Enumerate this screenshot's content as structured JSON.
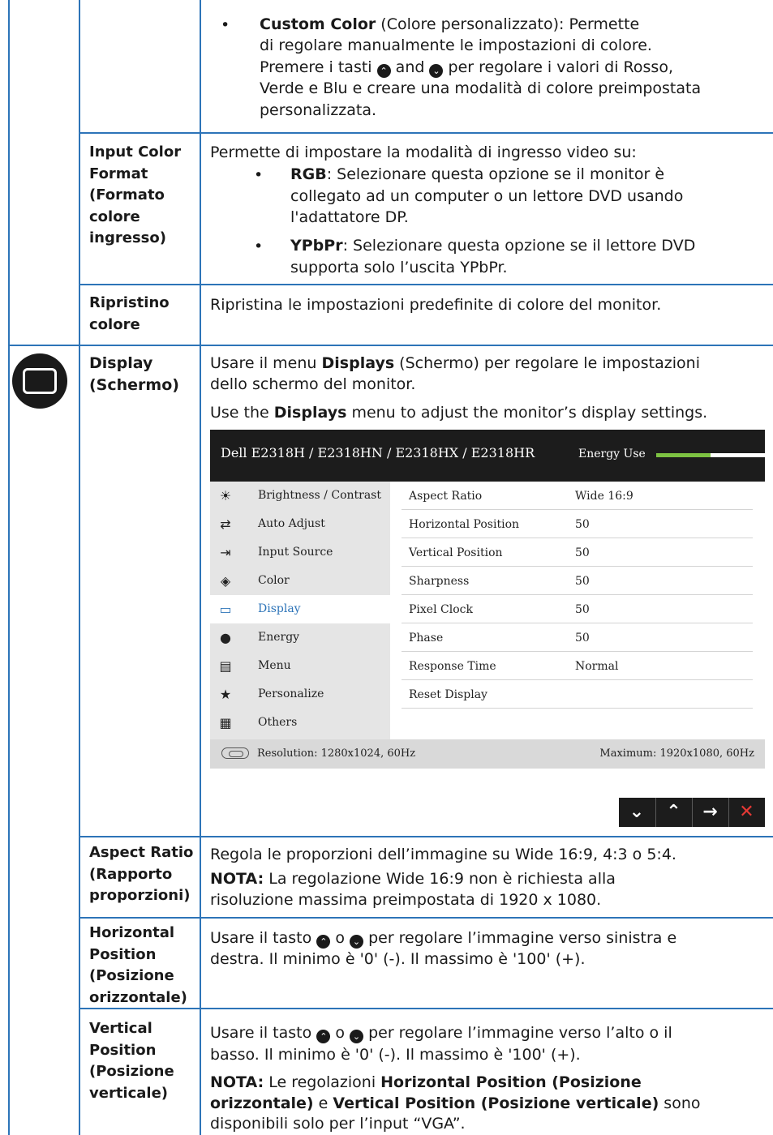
{
  "color_rows": {
    "custom_color": {
      "title": "Custom Color",
      "text1": " (Colore personalizzato): Permette",
      "text2": "di regolare manualmente le impostazioni di colore.",
      "text3a": "Premere i tasti",
      "text3b": "and",
      "text3c": "per regolare i valori di Rosso,",
      "text4": "Verde e Blu e creare una modalità di colore preimpostata",
      "text5": "personalizzata."
    },
    "input_color_format": {
      "label": [
        "Input Color",
        "Format",
        "(Formato",
        "colore",
        "ingresso)"
      ],
      "intro": "Permette di impostare la modalità di ingresso video su:",
      "rgb_title": "RGB",
      "rgb_text1": ": Selezionare questa opzione se il monitor è",
      "rgb_text2": "collegato ad un computer o un lettore DVD usando",
      "rgb_text3": "l'adattatore DP.",
      "ypbpr_title": "YPbPr",
      "ypbpr_text1": ": Selezionare questa opzione se il lettore DVD",
      "ypbpr_text2": "supporta solo l’uscita YPbPr."
    },
    "reset_color": {
      "label": [
        "Ripristino",
        "colore"
      ],
      "text": "Ripristina le impostazioni predefinite di colore del monitor."
    }
  },
  "display_section": {
    "icon": "display-icon",
    "label": [
      "Display",
      "(Schermo)"
    ],
    "p1a": "Usare il menu ",
    "p1b": "Displays",
    "p1c": " (Schermo) per regolare le impostazioni",
    "p1d": "dello schermo del monitor.",
    "p2a": "Use the ",
    "p2b": "Displays",
    "p2c": " menu to adjust the monitor’s display settings."
  },
  "osd": {
    "title": "Dell E2318H / E2318HN / E2318HX / E2318HR",
    "energy_label": "Energy Use",
    "energy_level": 0.5,
    "menu": [
      {
        "icon": "brightness-icon",
        "glyph": "☀",
        "label": "Brightness / Contrast"
      },
      {
        "icon": "auto-adjust-icon",
        "glyph": "⇄",
        "label": "Auto Adjust"
      },
      {
        "icon": "input-source-icon",
        "glyph": "⇥",
        "label": "Input Source"
      },
      {
        "icon": "color-icon",
        "glyph": "◈",
        "label": "Color"
      },
      {
        "icon": "display-icon",
        "glyph": "▭",
        "label": "Display"
      },
      {
        "icon": "energy-icon",
        "glyph": "●",
        "label": "Energy"
      },
      {
        "icon": "menu-icon",
        "glyph": "▤",
        "label": "Menu"
      },
      {
        "icon": "personalize-icon",
        "glyph": "★",
        "label": "Personalize"
      },
      {
        "icon": "others-icon",
        "glyph": "▦",
        "label": "Others"
      }
    ],
    "settings": [
      {
        "key": "Aspect Ratio",
        "value": "Wide 16:9"
      },
      {
        "key": "Horizontal Position",
        "value": "50"
      },
      {
        "key": "Vertical Position",
        "value": "50"
      },
      {
        "key": "Sharpness",
        "value": "50"
      },
      {
        "key": "Pixel Clock",
        "value": "50"
      },
      {
        "key": "Phase",
        "value": "50"
      },
      {
        "key": "Response Time",
        "value": "Normal"
      },
      {
        "key": "Reset Display",
        "value": ""
      }
    ],
    "resolution": "Resolution: 1280x1024, 60Hz",
    "maximum": "Maximum: 1920x1080, 60Hz",
    "nav": {
      "down": "⌄",
      "up": "⌃",
      "enter": "→",
      "exit": "✕"
    }
  },
  "aspect_ratio": {
    "label": [
      "Aspect Ratio",
      "(Rapporto",
      "proporzioni)"
    ],
    "text": "Regola le proporzioni dell’immagine su Wide 16:9, 4:3 o 5:4.",
    "note_title": "NOTA:",
    "note1": " La regolazione Wide 16:9 non è richiesta alla",
    "note2": "risoluzione massima preimpostata di 1920 x 1080."
  },
  "horizontal_position": {
    "label": [
      "Horizontal",
      "Position",
      "(Posizione",
      "orizzontale)"
    ],
    "t1a": "Usare il tasto",
    "t1b": "o",
    "t1c": "per regolare l’immagine verso sinistra e",
    "t2": "destra. Il minimo è '0' (-). Il massimo è '100' (+)."
  },
  "vertical_position": {
    "label": [
      "Vertical",
      "Position",
      "(Posizione",
      "verticale)"
    ],
    "t1a": " Usare il tasto",
    "t1b": "o",
    "t1c": "per regolare l’immagine verso l’alto o il",
    "t2": "basso. Il minimo è '0' (-). Il massimo è '100' (+).",
    "note_title": "NOTA:",
    "note_a": " Le regolazioni ",
    "note_b": "Horizontal Position (Posizione",
    "note_c": "orizzontale)",
    "note_d": " e ",
    "note_e": "Vertical Position (Posizione verticale)",
    "note_f": " sono",
    "note_g": "disponibili solo per l’input “VGA”."
  }
}
